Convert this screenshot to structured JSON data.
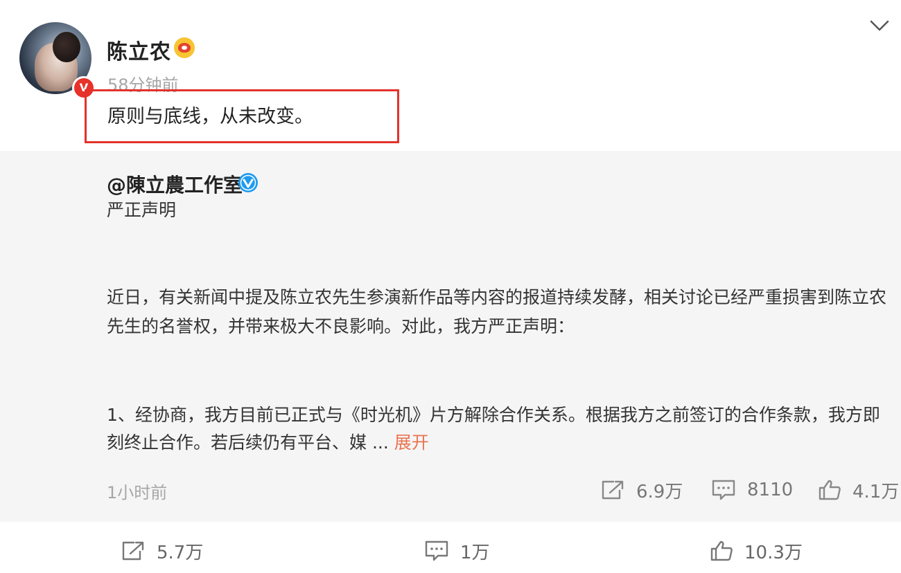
{
  "post": {
    "author": "陈立农",
    "time": "58分钟前",
    "text": "原则与底线，从未改变。",
    "icons": {
      "avatar": "avatar",
      "verified_badge": "orange-v-badge-icon",
      "member_badge": "weibo-member-icon",
      "collapse": "chevron-down-icon"
    },
    "verified_badge_text": "V"
  },
  "repost": {
    "author": "@陳立農工作室",
    "verified_icon": "blue-v-icon",
    "title": "严正声明",
    "paragraph1_line1": "近日，有关新闻中提及陈立农先生参演新作品等内容的报道持续发酵，相关讨论已经严重损害到陈立农",
    "paragraph1_line2": "先生的名誉权，并带来极大不良影响。对此，我方严正声明：",
    "paragraph2_line1": "1、经协商，我方目前已正式与《时光机》片方解除合作关系。根据我方之前签订的合作条款，我方即",
    "paragraph2_line2": "刻终止合作。若后续仍有平台、媒",
    "ellipsis": "...",
    "expand": "展开",
    "time": "1小时前",
    "stats": {
      "reposts": "6.9万",
      "comments": "8110",
      "likes": "4.1万"
    }
  },
  "bottom": {
    "reposts": "5.7万",
    "comments": "1万",
    "likes": "10.3万"
  },
  "colors": {
    "highlight_box": "#e3322b",
    "expand_link": "#eb7350",
    "verified_blue": "#1d9bf0",
    "verified_orange": "#e6322a",
    "repost_background": "#f5f5f5"
  }
}
